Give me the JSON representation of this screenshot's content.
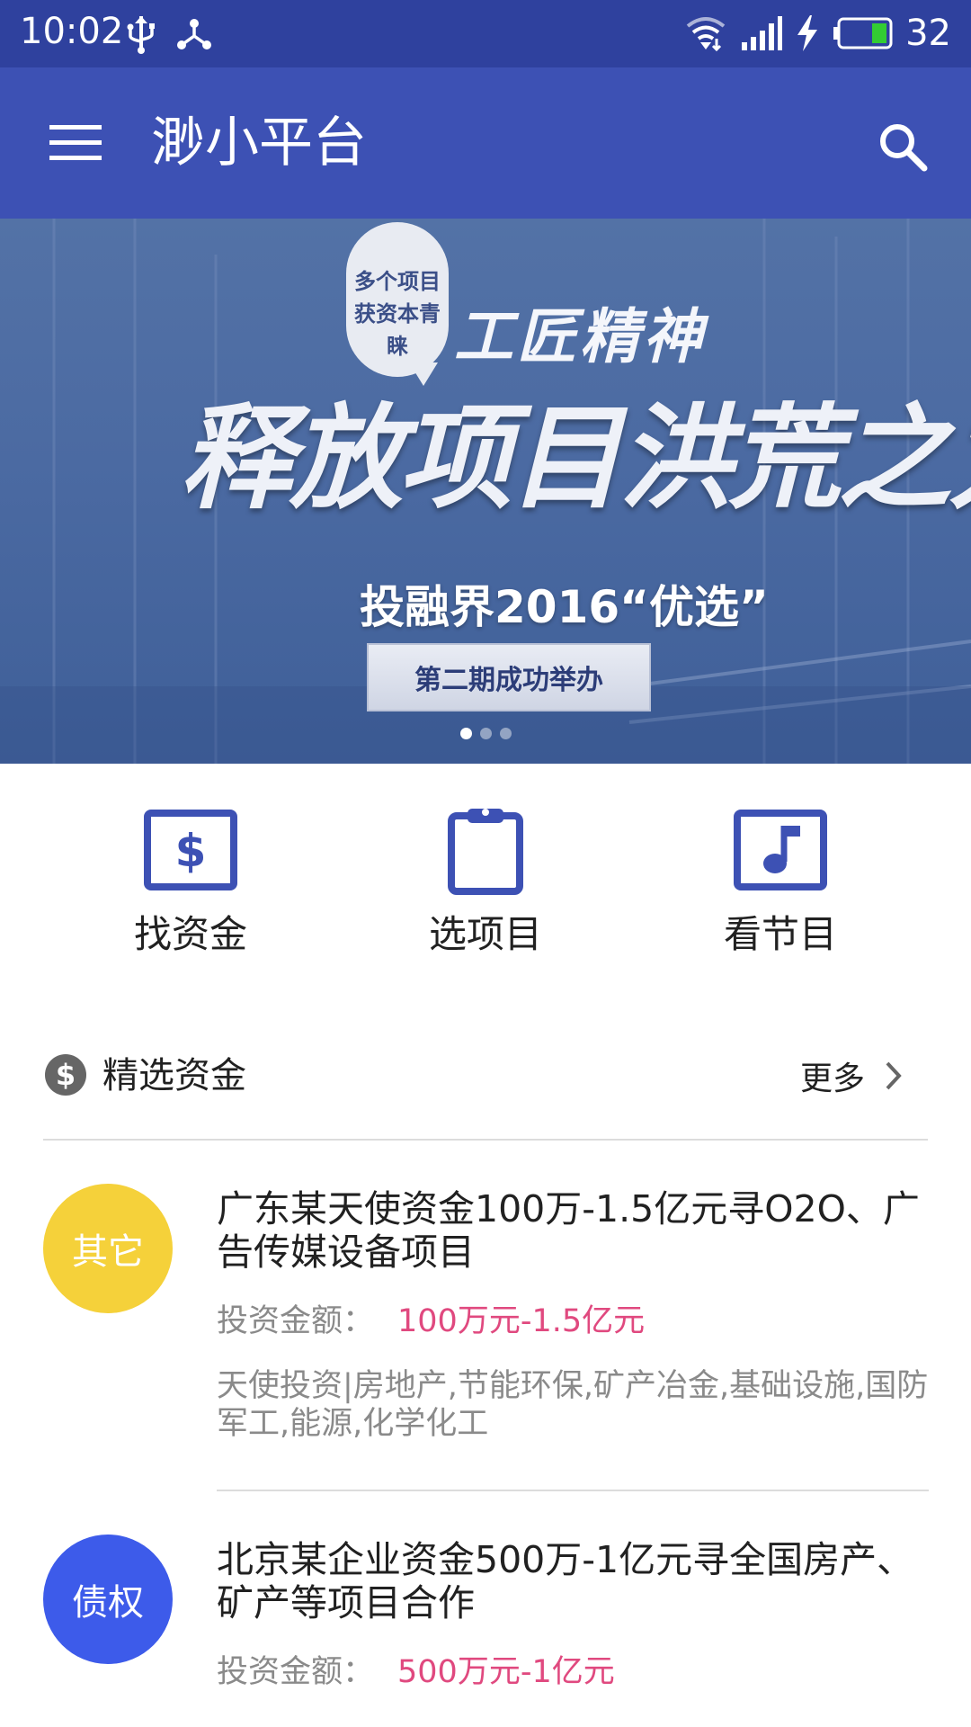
{
  "status_bar": {
    "time": "10:02",
    "battery_level": "32",
    "icons": [
      "usb-icon",
      "share-icon",
      "wifi-icon",
      "signal-icon",
      "charging-icon",
      "battery-icon"
    ],
    "battery_fraction": 0.32,
    "color": "#2f419e"
  },
  "app_bar": {
    "title": "渺小平台",
    "menu_icon": "menu-icon",
    "search_icon": "search-icon",
    "color": "#3d51b4"
  },
  "banner": {
    "bubble_text": "多个项目\n获资本青睐",
    "headline_small": "工匠精神",
    "headline_big": "释放项目洪荒之力",
    "subline": "投融界2016“优选”",
    "pill_text": "第二期成功举办",
    "slide_count": 3,
    "active_slide": 1
  },
  "quick_actions": [
    {
      "label": "找资金",
      "icon": "dollar-icon"
    },
    {
      "label": "选项目",
      "icon": "clipboard-icon"
    },
    {
      "label": "看节目",
      "icon": "music-icon"
    }
  ],
  "section": {
    "icon": "dollar-circle-icon",
    "title": "精选资金",
    "more_label": "更多",
    "more_icon": "chevron-right-icon"
  },
  "funds": [
    {
      "badge": "其它",
      "badge_color": "#f5d13a",
      "title": "广东某天使资金100万-1.5亿元寻O2O、广告传媒设备项目",
      "amount_label": "投资金额：",
      "amount_value": "100万元-1.5亿元",
      "tags": "天使投资|房地产,节能环保,矿产冶金,基础设施,国防军工,能源,化学化工"
    },
    {
      "badge": "债权",
      "badge_color": "#3d5bea",
      "title": "北京某企业资金500万-1亿元寻全国房产、矿产等项目合作",
      "amount_label": "投资金额：",
      "amount_value": "500万元-1亿元",
      "tags": ""
    }
  ],
  "accent_color": "#e0497f"
}
